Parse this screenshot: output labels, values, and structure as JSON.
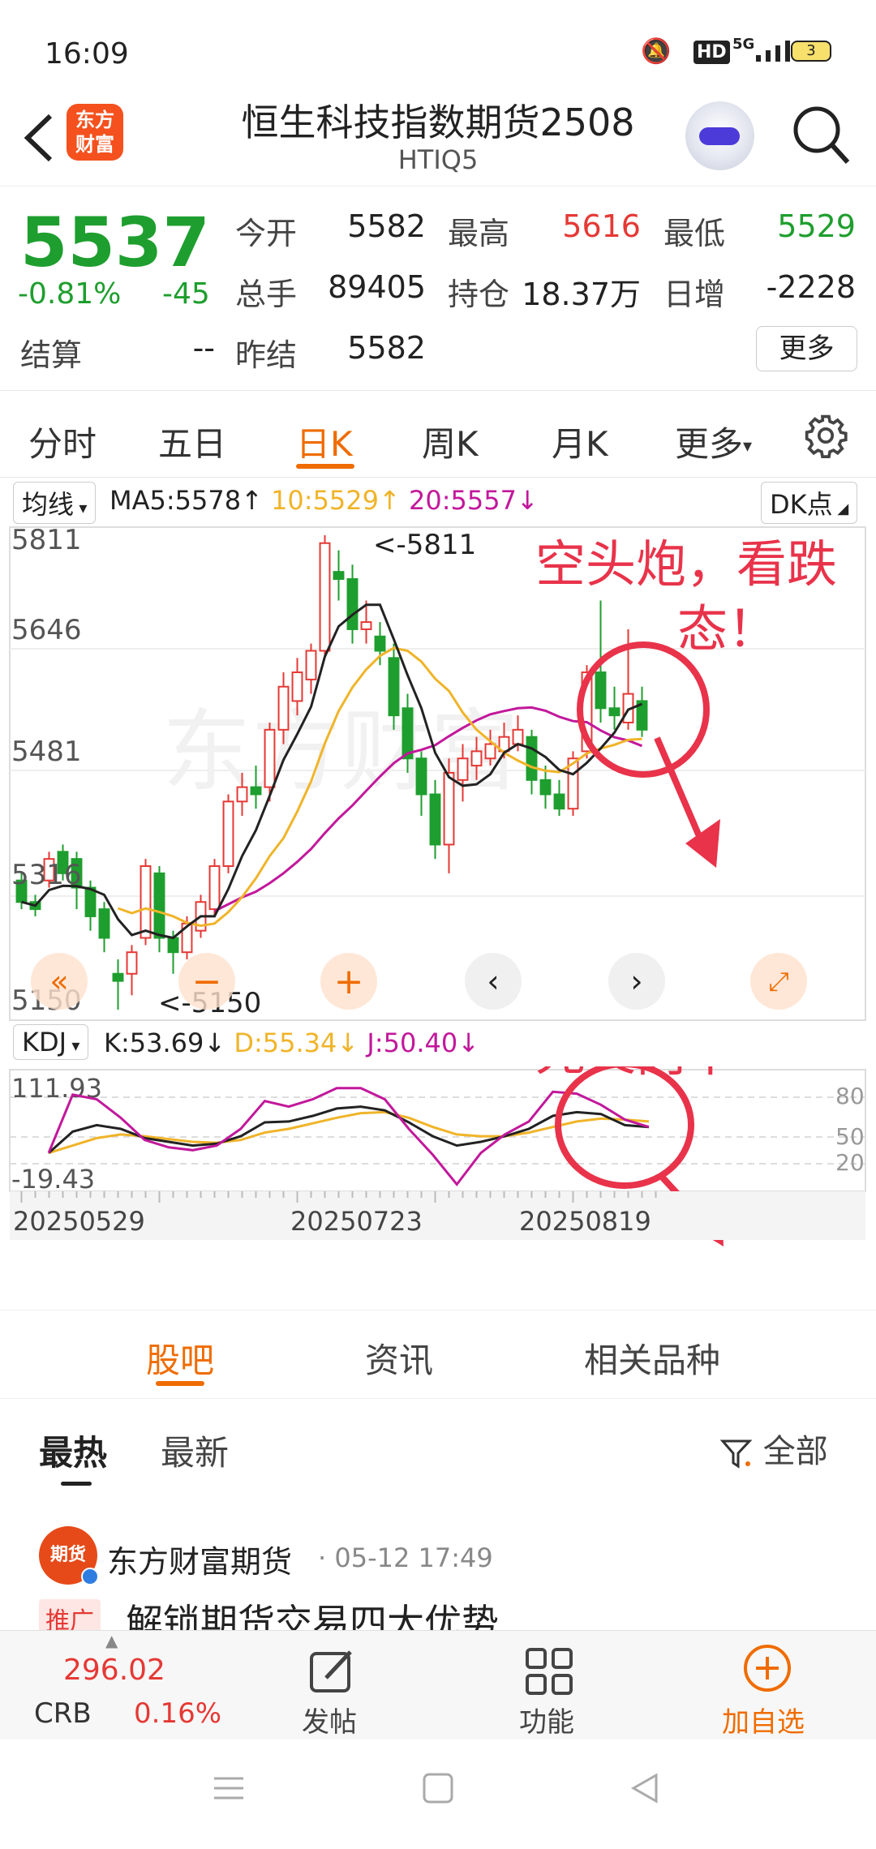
{
  "status_bar": {
    "time": "16:09",
    "network": "5G",
    "battery": "3"
  },
  "header": {
    "logo_text_1": "东方",
    "logo_text_2": "财富",
    "title": "恒生科技指数期货2508",
    "code": "HTIQ5"
  },
  "quote": {
    "price": "5537",
    "change_pct": "-0.81%",
    "change": "-45",
    "fields": [
      {
        "label": "今开",
        "value": "5582",
        "color": "#222222"
      },
      {
        "label": "最高",
        "value": "5616",
        "color": "#e53935"
      },
      {
        "label": "最低",
        "value": "5529",
        "color": "#1e9e2e"
      },
      {
        "label": "总手",
        "value": "89405",
        "color": "#222222"
      },
      {
        "label": "持仓",
        "value": "18.37万",
        "color": "#222222"
      },
      {
        "label": "日增",
        "value": "-2228",
        "color": "#222222"
      },
      {
        "label": "结算",
        "value": "--",
        "color": "#222222"
      },
      {
        "label": "昨结",
        "value": "5582",
        "color": "#222222"
      }
    ],
    "more_button": "更多"
  },
  "tabs": [
    "分时",
    "五日",
    "日K",
    "周K",
    "月K",
    "更多"
  ],
  "active_tab": "日K",
  "kline": {
    "indicator_select": "均线",
    "ma5": "MA5:5578↑",
    "ma10": "10:5529↑",
    "ma20": "20:5557↓",
    "dk_button": "DK点",
    "y_labels": [
      "5811",
      "5646",
      "5481",
      "5316",
      "5150"
    ],
    "high_marker": "<-5811",
    "low_marker": "<-5150",
    "annotation_1": "空头炮，看跌",
    "annotation_1b": "态！",
    "colors": {
      "up": "#e53935",
      "down": "#1e9e2e",
      "ma5": "#222222",
      "ma10": "#f0b429",
      "ma20": "#c2189b",
      "annotation": "#e8334a"
    }
  },
  "kdj": {
    "indicator_select": "KDJ",
    "k": "K:53.69↓",
    "d": "D:55.34↓",
    "j": "J:50.40↓",
    "y_top": "111.93",
    "y_bottom": "-19.43",
    "levels": [
      "80",
      "50",
      "20"
    ],
    "annotation": "死叉向下",
    "dates": [
      "20250529",
      "20250723",
      "20250819"
    ]
  },
  "subtabs": [
    "股吧",
    "资讯",
    "相关品种"
  ],
  "active_subtab": "股吧",
  "feed": {
    "sort_hot": "最热",
    "sort_new": "最新",
    "filter_label": "全部",
    "post": {
      "avatar_text": "期货",
      "author": "东方财富期货",
      "time": "· 05-12 17:49",
      "tag": "推广",
      "title": "解锁期货交易四大优势"
    }
  },
  "bottombar": {
    "crb_value": "296.02",
    "crb_label": "CRB",
    "crb_change": "0.16%",
    "post": "发帖",
    "function": "功能",
    "add": "加自选"
  }
}
